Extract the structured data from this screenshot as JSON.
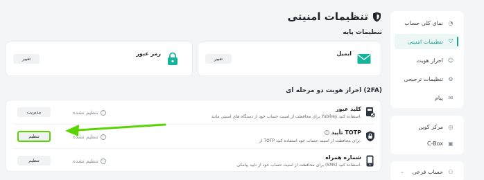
{
  "page": {
    "title": "تنظیمات امنیتی",
    "basic_heading": "تنظیمات پایه",
    "twofa_heading": "احراز هویت دو مرحله ای (2FA)"
  },
  "sidebar": {
    "items": [
      {
        "label": "نمای کلی حساب",
        "icon": "account-overview-icon",
        "active": false
      },
      {
        "label": "تنظیمات امنیتی",
        "icon": "shield-icon",
        "active": true
      },
      {
        "label": "احراز هویت",
        "icon": "identity-icon",
        "active": false
      },
      {
        "label": "تنظیمات ترجیحی",
        "icon": "preferences-icon",
        "active": false
      },
      {
        "label": "پیام",
        "icon": "message-icon",
        "active": false
      }
    ],
    "group2": [
      {
        "label": "مرکز کوین",
        "icon": "coin-icon"
      },
      {
        "label": "C-Box",
        "icon": "gift-box-icon"
      }
    ],
    "group3": [
      {
        "label": "حساب فرعی",
        "icon": "sub-account-icon"
      }
    ]
  },
  "basic": {
    "email_label": "ایمیل",
    "email_button": "تغییر",
    "password_label": "رمز عبور",
    "password_button": "تغییر"
  },
  "twofa": {
    "rows": [
      {
        "title": "کلید عبور",
        "desc": "برای محافظت از امنیت حساب خود از دستگاه های امنیتی مانند Yubikey استفاده کنید.",
        "status": "تنظیم نشده",
        "button": "مدیریت"
      },
      {
        "title": "تأیید TOTP",
        "desc": "از TOTP برای محافظت از امنیت حساب خود استفاده کنید.",
        "status": "تنظیم نشده",
        "button": "تنظیم"
      },
      {
        "title": "شماره همراه",
        "desc": "برای محافظت از امنیت حساب خود از تایید پیامکی (SMS) استفاده کنید.",
        "status": "تنظیم نشده",
        "button": "تنظیم"
      }
    ]
  },
  "colors": {
    "accent": "#12a58f",
    "arrow": "#5ad400"
  }
}
